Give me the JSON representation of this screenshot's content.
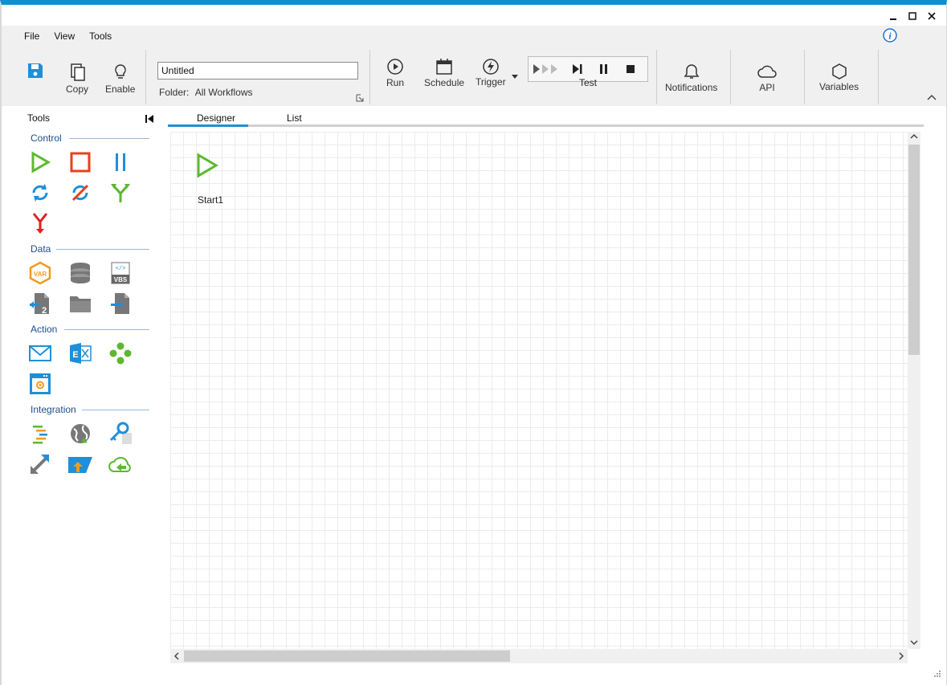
{
  "menu": {
    "file": "File",
    "view": "View",
    "tools": "Tools"
  },
  "ribbon": {
    "copy": "Copy",
    "enable": "Enable",
    "workflow_name": "Untitled",
    "folder_label": "Folder:",
    "folder_value": "All Workflows",
    "run": "Run",
    "schedule": "Schedule",
    "trigger": "Trigger",
    "test": "Test",
    "notifications": "Notifications",
    "api": "API",
    "variables": "Variables"
  },
  "tools_panel": {
    "title": "Tools",
    "sections": {
      "control": "Control",
      "data": "Data",
      "action": "Action",
      "integration": "Integration"
    },
    "data_tools": {
      "var": "VAR",
      "vbs": "VBS"
    }
  },
  "tabs": {
    "designer": "Designer",
    "list": "List"
  },
  "canvas": {
    "start_node_label": "Start1"
  },
  "colors": {
    "accent": "#1e90d6",
    "green": "#5cb82e",
    "red": "#e8401c",
    "orange": "#f29b1d",
    "blue": "#1f8fd8"
  }
}
